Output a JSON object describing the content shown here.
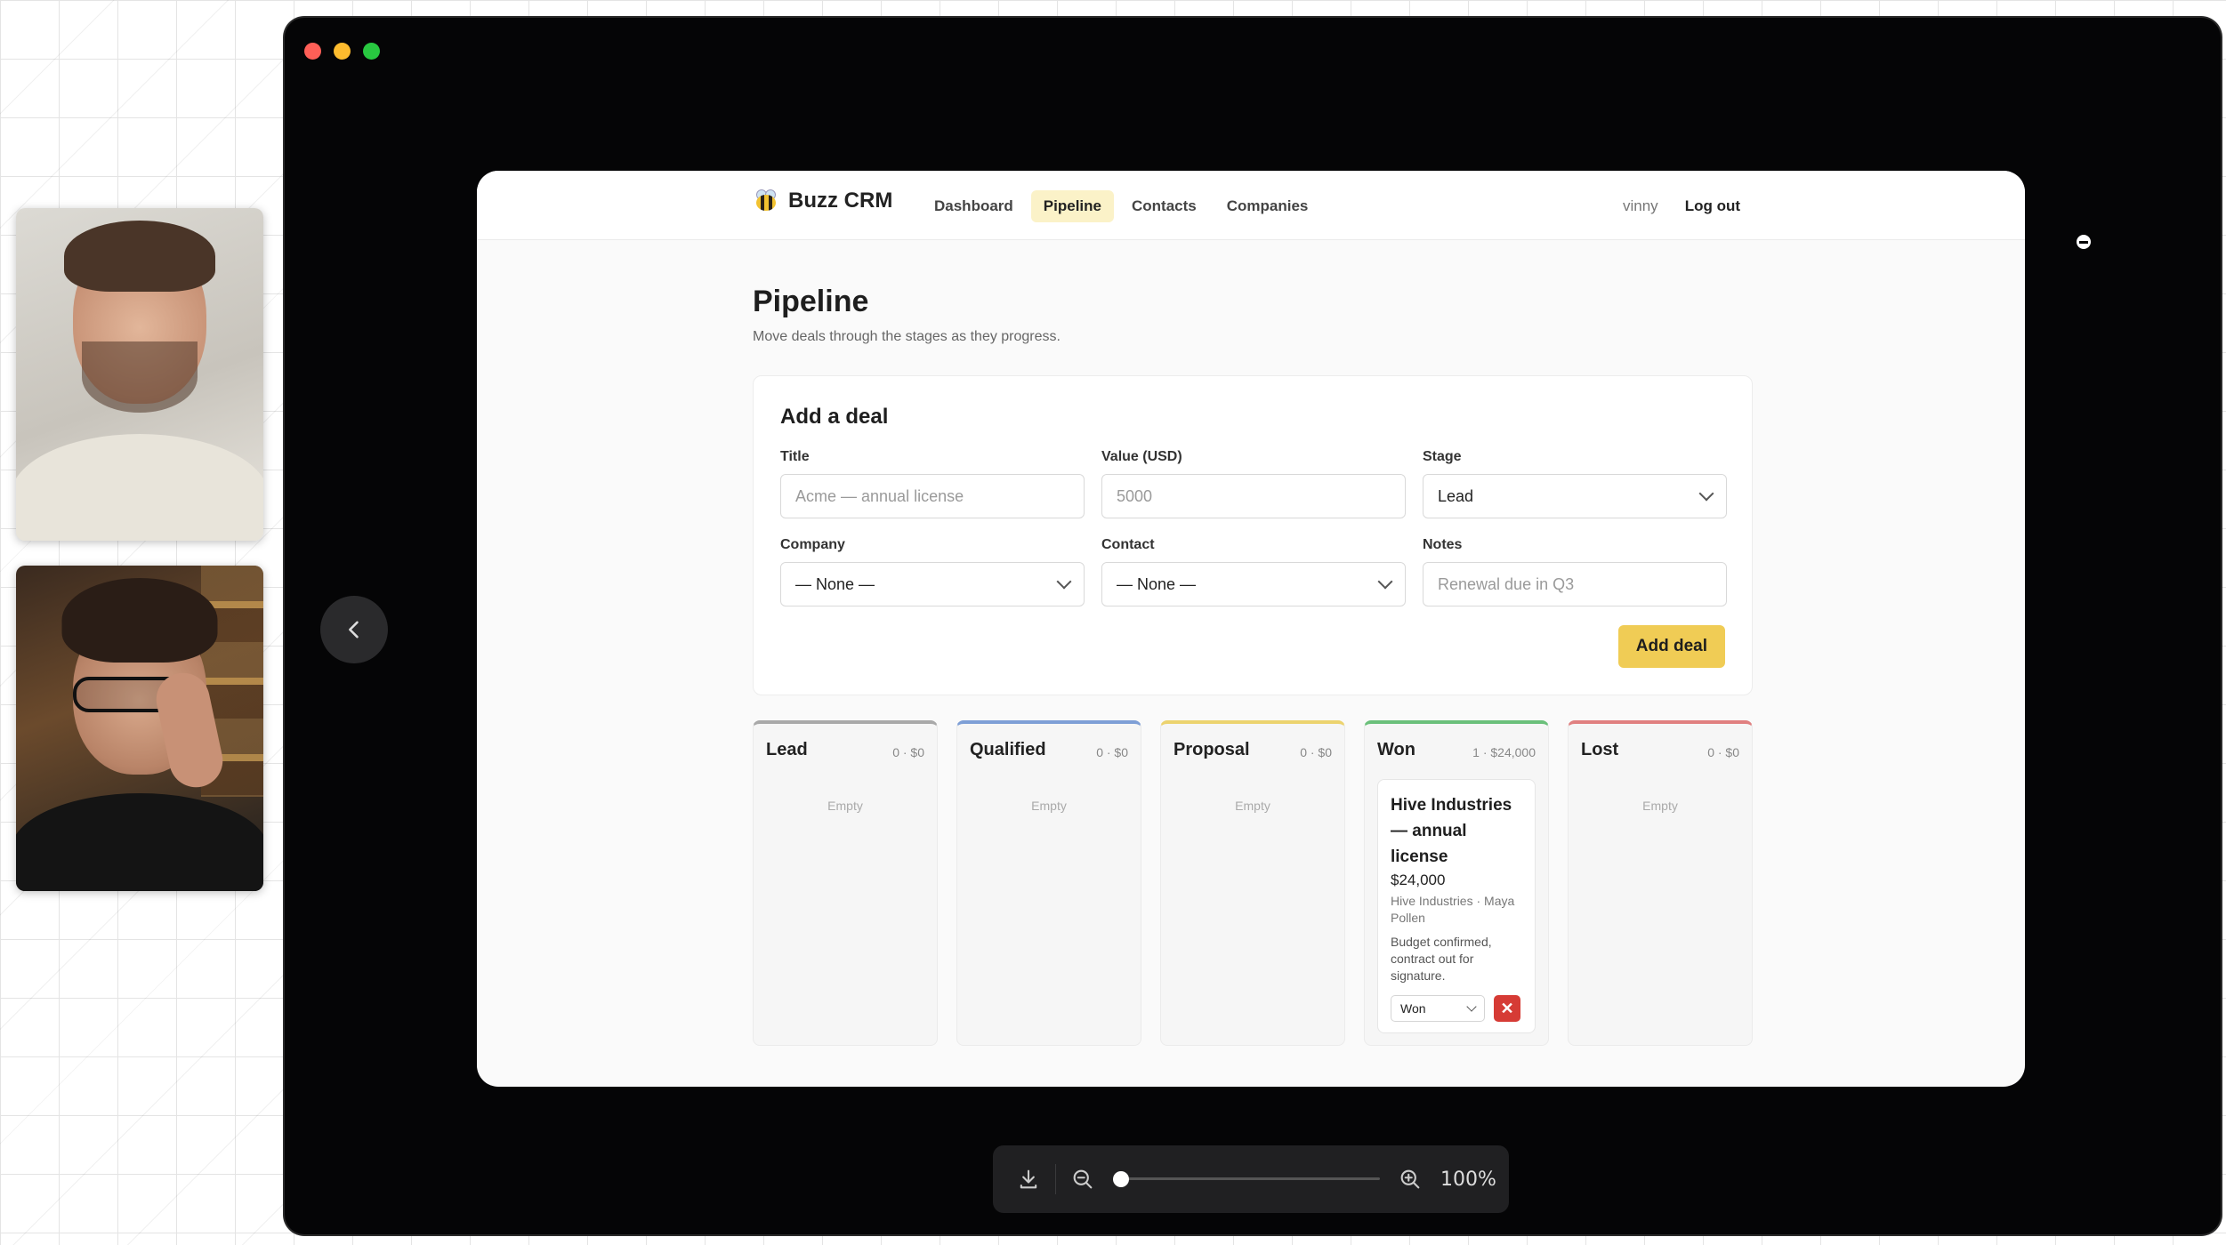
{
  "app": {
    "brand": "Buzz CRM",
    "nav": [
      "Dashboard",
      "Pipeline",
      "Contacts",
      "Companies"
    ],
    "active_nav": "Pipeline",
    "user": "vinny",
    "logout": "Log out"
  },
  "page": {
    "title": "Pipeline",
    "subtitle": "Move deals through the stages as they progress."
  },
  "add_deal": {
    "heading": "Add a deal",
    "title_label": "Title",
    "title_placeholder": "Acme — annual license",
    "value_label": "Value (USD)",
    "value_placeholder": "5000",
    "stage_label": "Stage",
    "stage_value": "Lead",
    "company_label": "Company",
    "company_value": "— None —",
    "contact_label": "Contact",
    "contact_value": "— None —",
    "notes_label": "Notes",
    "notes_placeholder": "Renewal due in Q3",
    "submit": "Add deal"
  },
  "columns": [
    {
      "name": "Lead",
      "meta": "0 · $0",
      "empty": "Empty",
      "color": "#a9a9a9"
    },
    {
      "name": "Qualified",
      "meta": "0 · $0",
      "empty": "Empty",
      "color": "#7e9fd6"
    },
    {
      "name": "Proposal",
      "meta": "0 · $0",
      "empty": "Empty",
      "color": "#ecd36f"
    },
    {
      "name": "Won",
      "meta": "1 · $24,000",
      "empty": "",
      "color": "#6bc07b"
    },
    {
      "name": "Lost",
      "meta": "0 · $0",
      "empty": "Empty",
      "color": "#e08080"
    }
  ],
  "won_deal": {
    "title": "Hive Industries — annual license",
    "value": "$24,000",
    "company_contact": "Hive Industries · Maya Pollen",
    "notes": "Budget confirmed, contract out for signature.",
    "stage": "Won",
    "delete": "✕"
  },
  "viewer": {
    "zoom": "100%",
    "zoom_fraction": 0
  },
  "colors": {
    "accent": "#f0cc55",
    "danger": "#d63b35"
  }
}
